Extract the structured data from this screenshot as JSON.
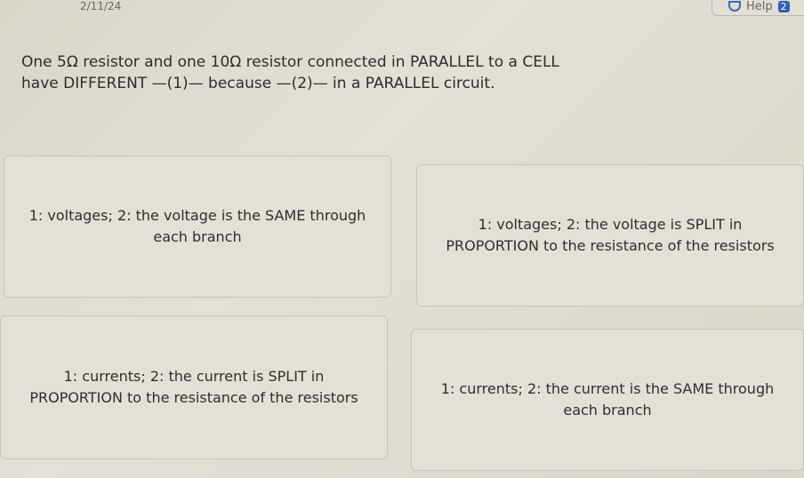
{
  "header": {
    "date": "2/11/24",
    "help_label": "Help",
    "help_badge": "2",
    "help_icon": "shield-icon"
  },
  "question": "One 5Ω resistor and one 10Ω resistor connected in PARALLEL to a CELL have DIFFERENT —(1)— because —(2)— in a PARALLEL circuit.",
  "options": [
    {
      "label": "1: voltages; 2: the voltage is the SAME through each branch"
    },
    {
      "label": "1: voltages; 2: the voltage is SPLIT in PROPORTION to the resistance of the resistors"
    },
    {
      "label": "1: currents; 2: the current is SPLIT in PROPORTION to the resistance of the resistors"
    },
    {
      "label": "1: currents; 2: the current is the SAME through each branch"
    }
  ]
}
